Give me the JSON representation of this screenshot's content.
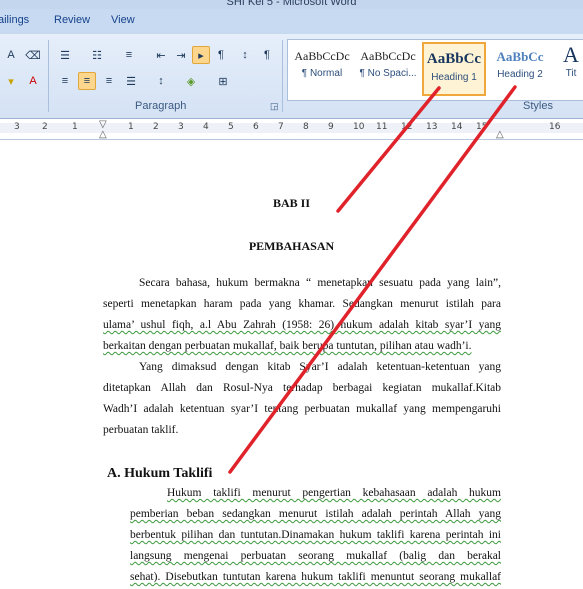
{
  "window": {
    "title": "SHI Kel 5 - Microsoft Word"
  },
  "tabs": [
    "ailings",
    "Review",
    "View"
  ],
  "ribbon": {
    "paragraph_group_label": "Paragraph",
    "styles_group_label": "Styles",
    "styles": [
      {
        "sample": "AaBbCcDc",
        "name": "¶ Normal"
      },
      {
        "sample": "AaBbCcDc",
        "name": "¶ No Spaci..."
      },
      {
        "sample": "AaBbCc",
        "name": "Heading 1",
        "selected": true
      },
      {
        "sample": "AaBbCc",
        "name": "Heading 2"
      },
      {
        "sample": "A",
        "name": "Tit"
      }
    ]
  },
  "ruler": {
    "numbers": [
      "3",
      "2",
      "1",
      "1",
      "2",
      "3",
      "4",
      "5",
      "6",
      "7",
      "8",
      "9",
      "10",
      "11",
      "12",
      "13",
      "14",
      "15",
      "16"
    ]
  },
  "document": {
    "chapter": "BAB II",
    "title": "PEMBAHASAN",
    "p1": [
      "Secara bahasa, hukum bermakna “ menetapkan sesuatu pada yang lain”,",
      "seperti menetapkan haram pada yang khamar. Sedangkan menurut istilah para",
      "ulama’ ushul fiqh, a.l Abu Zahrah (1958: 26) hukum adalah kitab syar’I yang",
      "berkaitan dengan perbuatan mukallaf, baik berupa tuntutan, pilihan atau wadh’i."
    ],
    "p2": [
      "Yang dimaksud dengan kitab Syar’I adalah ketentuan-ketentuan yang",
      "ditetapkan Allah dan Rosul-Nya terhadap berbagai kegiatan mukallaf.Kitab",
      "Wadh’I adalah ketentuan syar’I tentang perbuatan mukallaf yang mempengaruhi",
      "perbuatan taklif."
    ],
    "section_heading": "A.  Hukum Taklifi",
    "p3": [
      "Hukum taklifi menurut pengertian kebahasaan adalah hukum",
      "pemberian beban sedangkan menurut istilah adalah perintah Allah yang",
      "berbentuk pilihan dan tuntutan.Dinamakan hukum taklifi karena perintah ini",
      "langsung mengenai perbuatan seorang mukallaf (balig dan berakal",
      "sehat). Disebutkan tuntutan karena hukum taklifi menuntut seorang mukallaf"
    ]
  },
  "annotation": {
    "color": "#e0232b"
  }
}
